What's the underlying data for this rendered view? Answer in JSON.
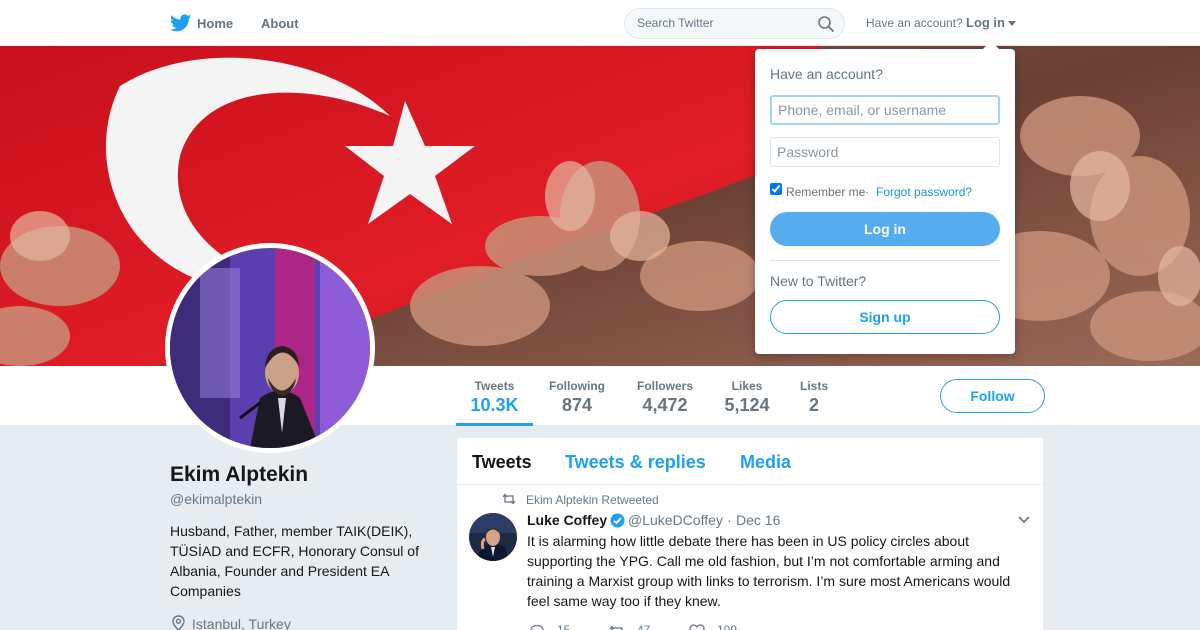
{
  "nav": {
    "home_label": "Home",
    "about_label": "About",
    "search_placeholder": "Search Twitter",
    "have_account": "Have an account?",
    "login_label": "Log in"
  },
  "profile_nav": {
    "stats": [
      {
        "label": "Tweets",
        "value": "10.3K"
      },
      {
        "label": "Following",
        "value": "874"
      },
      {
        "label": "Followers",
        "value": "4,472"
      },
      {
        "label": "Likes",
        "value": "5,124"
      },
      {
        "label": "Lists",
        "value": "2"
      }
    ],
    "follow_label": "Follow"
  },
  "profile": {
    "name": "Ekim Alptekin",
    "handle": "@ekimalptekin",
    "bio": "Husband, Father, member TAIK(DEIK), TÜSİAD and ECFR, Honorary Consul of Albania, Founder and President EA Companies",
    "location": "Istanbul, Turkey"
  },
  "timeline": {
    "tabs": [
      "Tweets",
      "Tweets & replies",
      "Media"
    ],
    "tweet": {
      "retweet_context": "Ekim Alptekin Retweeted",
      "author_name": "Luke Coffey",
      "author_handle": "@LukeDCoffey",
      "separator": "·",
      "date": "Dec 16",
      "text": "It is alarming how little debate there has been in US policy circles about supporting the YPG. Call me old fashion, but I’m not comfortable arming and training a Marxist group with links to terrorism. I’m sure most Americans would feel same way too if they knew.",
      "replies": "15",
      "retweets": "47",
      "likes": "109"
    }
  },
  "login_dropdown": {
    "title": "Have an account?",
    "username_placeholder": "Phone, email, or username",
    "password_placeholder": "Password",
    "remember_label": "Remember me",
    "separator": "·",
    "forgot_label": "Forgot password?",
    "login_button": "Log in",
    "new_prompt": "New to Twitter?",
    "signup_button": "Sign up"
  },
  "colors": {
    "accent": "#1da1f2",
    "login_button": "#55acee",
    "flag_red": "#e30a17"
  }
}
